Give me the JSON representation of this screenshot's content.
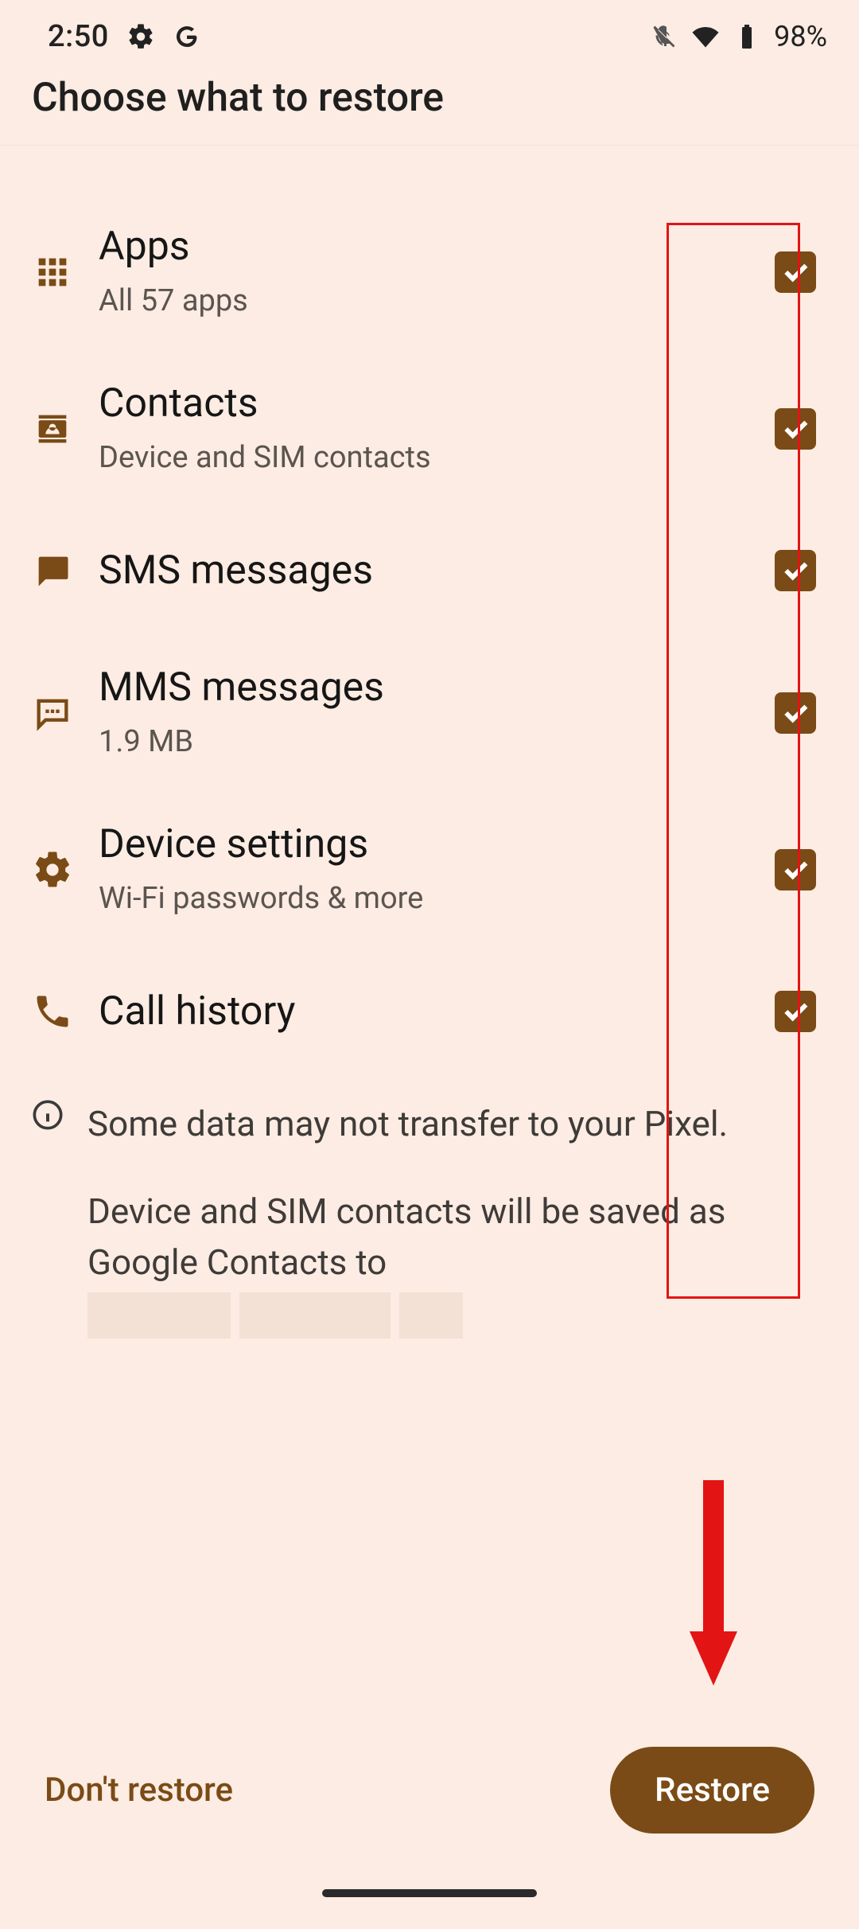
{
  "statusbar": {
    "time": "2:50",
    "battery": "98%"
  },
  "title": "Choose what to restore",
  "items": [
    {
      "title": "Apps",
      "sub": "All 57 apps",
      "icon": "apps"
    },
    {
      "title": "Contacts",
      "sub": "Device and SIM contacts",
      "icon": "contacts"
    },
    {
      "title": "SMS messages",
      "sub": "",
      "icon": "sms"
    },
    {
      "title": "MMS messages",
      "sub": "1.9 MB",
      "icon": "mms"
    },
    {
      "title": "Device settings",
      "sub": "Wi-Fi passwords & more",
      "icon": "settings"
    },
    {
      "title": "Call history",
      "sub": "",
      "icon": "call"
    }
  ],
  "info": {
    "line1": "Some data may not transfer to your Pixel.",
    "line2": "Device and SIM contacts will be saved as Google Contacts to"
  },
  "buttons": {
    "dont": "Don't restore",
    "restore": "Restore"
  }
}
